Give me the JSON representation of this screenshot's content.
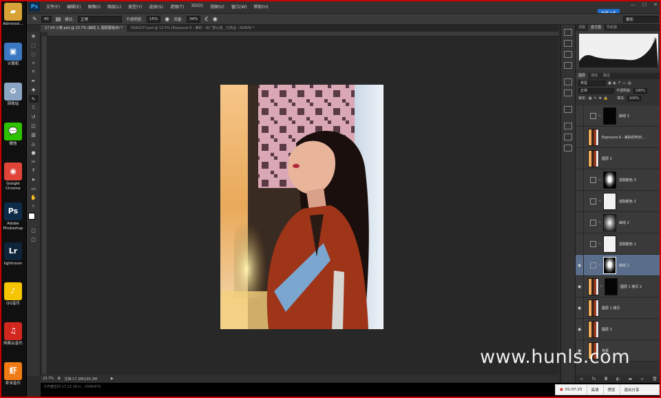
{
  "desktop": {
    "icons": [
      {
        "label": "Administ...",
        "icon": "folder-icon",
        "color": "#d8a236"
      },
      {
        "label": "计算机",
        "icon": "computer-icon",
        "color": "#3a78c2"
      },
      {
        "label": "回收站",
        "icon": "recycle-bin-icon",
        "color": "#8aa6c4"
      },
      {
        "label": "微信",
        "icon": "wechat-icon",
        "color": "#2dc100"
      },
      {
        "label": "Google Chrome",
        "icon": "chrome-icon",
        "color": "#e0453a"
      },
      {
        "label": "Adobe Photoshop",
        "icon": "photoshop-icon",
        "color": "#0e2c4a"
      },
      {
        "label": "lightroom",
        "icon": "lightroom-icon",
        "color": "#0e2438"
      },
      {
        "label": "QQ音乐",
        "icon": "qq-music-icon",
        "color": "#f4c500"
      },
      {
        "label": "网易云音乐",
        "icon": "netease-music-icon",
        "color": "#d2271e"
      },
      {
        "label": "虾米音乐",
        "icon": "xiami-music-icon",
        "color": "#f07a14"
      }
    ]
  },
  "menubar": {
    "logo": "Ps",
    "items": [
      "文件(F)",
      "编辑(E)",
      "图像(I)",
      "图层(L)",
      "类型(Y)",
      "选择(S)",
      "滤镜(T)",
      "3D(D)",
      "视图(V)",
      "窗口(W)",
      "帮助(H)"
    ],
    "cloud_button": "拍痕上传",
    "workspace": "摄影"
  },
  "options": {
    "brush_size": "40",
    "mode_label": "模式:",
    "mode_value": "正常",
    "opacity_label": "不透明度:",
    "opacity_value": "15%",
    "flow_label": "流量:",
    "flow_value": "34%"
  },
  "tabs": [
    {
      "label": "17.04 小卷.psd @ 23.7% (曲线 1, 图层蒙版/8) *",
      "active": true
    },
    {
      "label": "55A0237.psd @ 12.5% (Exposure 6 - 美好 - 出厂默认值 , 已商业 , RGB/8) *",
      "active": false
    }
  ],
  "status": {
    "zoom": "23.7%",
    "doc": "文档:17.2M/155.3M"
  },
  "taskbar_text": "工作盘空间  17.12.18.rr...  55A0479",
  "panels": {
    "top_tabs": [
      "调整",
      "直方图",
      "导航器"
    ],
    "mid_tabs": [
      "图层",
      "通道",
      "路径"
    ],
    "kind_label": "类型",
    "blend_mode": "正常",
    "opacity_label": "不透明度:",
    "opacity_value": "100%",
    "lock_label": "锁定:",
    "fill_label": "填充:",
    "fill_value": "100%"
  },
  "layers": [
    {
      "name": "曲线 3",
      "visible": false,
      "type": "adjustment",
      "mask": "dark",
      "selected": false
    },
    {
      "name": "Exposure 6 - 美好的怀旧...",
      "visible": false,
      "type": "photo",
      "mask": "none",
      "selected": false
    },
    {
      "name": "图层 2",
      "visible": false,
      "type": "photo",
      "mask": "none",
      "selected": false
    },
    {
      "name": "选取颜色 3",
      "visible": false,
      "type": "adjustment",
      "mask": "blob",
      "selected": false
    },
    {
      "name": "选取颜色 2",
      "visible": false,
      "type": "adjustment",
      "mask": "white",
      "selected": false
    },
    {
      "name": "曲线 2",
      "visible": false,
      "type": "adjustment",
      "mask": "grey",
      "selected": false
    },
    {
      "name": "选取颜色 1",
      "visible": false,
      "type": "adjustment",
      "mask": "white",
      "selected": false
    },
    {
      "name": "曲线 1",
      "visible": true,
      "type": "adjustment",
      "mask": "blob",
      "selected": true
    },
    {
      "name": "图层 1 拷贝 2",
      "visible": true,
      "type": "photo",
      "mask": "dark",
      "selected": false
    },
    {
      "name": "图层 1 拷贝",
      "visible": true,
      "type": "photo",
      "mask": "none",
      "selected": false
    },
    {
      "name": "图层 1",
      "visible": true,
      "type": "photo",
      "mask": "none",
      "selected": false
    },
    {
      "name": "背景",
      "visible": true,
      "type": "photo",
      "mask": "none",
      "selected": false
    }
  ],
  "watermark": "www.hunls.com",
  "recorder": {
    "time": "01:07:25",
    "buttons": [
      "高清",
      "预览",
      "退出分享"
    ]
  }
}
